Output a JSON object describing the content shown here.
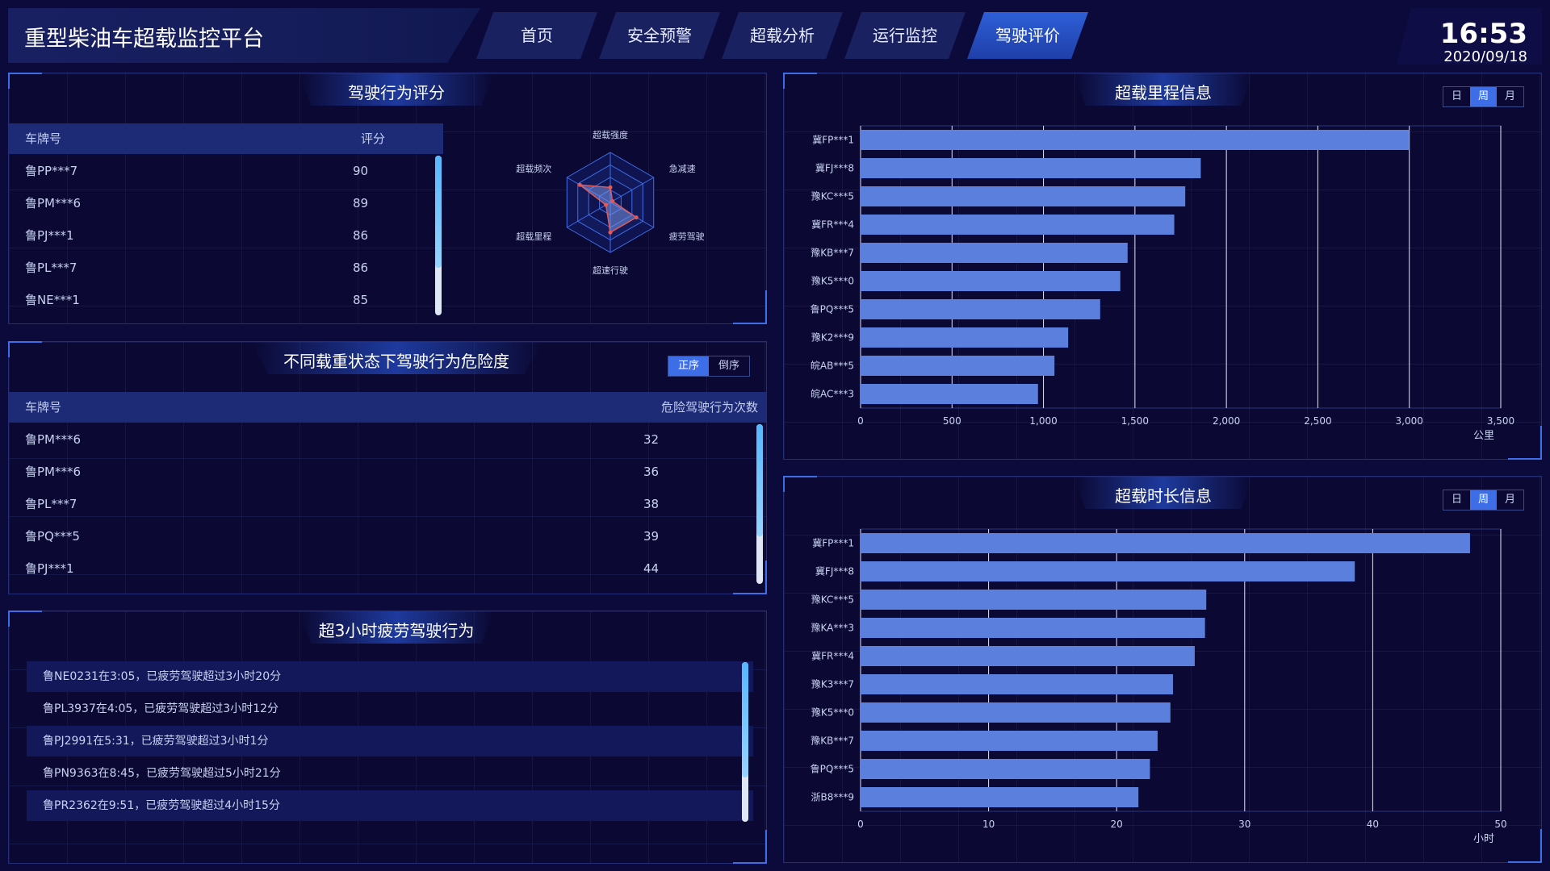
{
  "header": {
    "title": "重型柴油车超载监控平台",
    "tabs": [
      {
        "label": "首页",
        "active": false
      },
      {
        "label": "安全预警",
        "active": false
      },
      {
        "label": "超载分析",
        "active": false
      },
      {
        "label": "运行监控",
        "active": false
      },
      {
        "label": "驾驶评价",
        "active": true
      }
    ],
    "time": "16:53",
    "date": "2020/09/18"
  },
  "colors": {
    "accent": "#3d6ee8",
    "bar": "#5b7fdc",
    "background": "#0c0a3a",
    "radar_line": "#e05a5a"
  },
  "driving_score": {
    "title": "驾驶行为评分",
    "columns": [
      "车牌号",
      "评分"
    ],
    "rows": [
      {
        "plate": "鲁PP***7",
        "score": "90"
      },
      {
        "plate": "鲁PM***6",
        "score": "89"
      },
      {
        "plate": "鲁PJ***1",
        "score": "86"
      },
      {
        "plate": "鲁PL***7",
        "score": "86"
      },
      {
        "plate": "鲁NE***1",
        "score": "85"
      }
    ],
    "scroll_fraction": 0.7
  },
  "chart_data": [
    {
      "type": "radar",
      "indicators": [
        "超载强度",
        "急减速",
        "疲劳驾驶",
        "超速行驶",
        "超载里程",
        "超载频次"
      ],
      "values": [
        0.3,
        0.05,
        0.6,
        0.6,
        0.1,
        0.7
      ],
      "max": 1
    },
    {
      "type": "bar",
      "title": "超载里程信息",
      "orientation": "horizontal",
      "categories": [
        "冀FP***1",
        "冀FJ***8",
        "豫KC***5",
        "冀FR***4",
        "豫KB***7",
        "豫K5***0",
        "鲁PQ***5",
        "豫K2***9",
        "皖AB***5",
        "皖AC***3"
      ],
      "values": [
        3000,
        1860,
        1775,
        1715,
        1460,
        1420,
        1310,
        1135,
        1060,
        970
      ],
      "x_ticks": [
        "0",
        "500",
        "1,000",
        "1,500",
        "2,000",
        "2,500",
        "3,000",
        "3,500"
      ],
      "xlim": [
        0,
        3500
      ],
      "unit": "公里"
    },
    {
      "type": "bar",
      "title": "超载时长信息",
      "orientation": "horizontal",
      "categories": [
        "冀FP***1",
        "冀FJ***8",
        "豫KC***5",
        "豫KA***3",
        "冀FR***4",
        "豫K3***7",
        "豫K5***0",
        "豫KB***7",
        "鲁PQ***5",
        "浙B8***9"
      ],
      "values": [
        47.6,
        38.6,
        27,
        26.9,
        26.1,
        24.4,
        24.2,
        23.2,
        22.6,
        21.7
      ],
      "x_ticks": [
        "0",
        "10",
        "20",
        "30",
        "40",
        "50"
      ],
      "xlim": [
        0,
        50
      ],
      "unit": "小时"
    }
  ],
  "danger_table": {
    "title": "不同载重状态下驾驶行为危险度",
    "sort_labels": [
      "正序",
      "倒序"
    ],
    "columns": [
      "车牌号",
      "危险驾驶行为次数"
    ],
    "rows": [
      {
        "plate": "鲁PM***6",
        "count": "32"
      },
      {
        "plate": "鲁PM***6",
        "count": "36"
      },
      {
        "plate": "鲁PL***7",
        "count": "38"
      },
      {
        "plate": "鲁PQ***5",
        "count": "39"
      },
      {
        "plate": "鲁PJ***1",
        "count": "44"
      }
    ],
    "scroll_fraction": 0.7
  },
  "fatigue": {
    "title": "超3小时疲劳驾驶行为",
    "items": [
      "鲁NE0231在3:05，已疲劳驾驶超过3小时20分",
      "鲁PL3937在4:05，已疲劳驾驶超过3小时12分",
      "鲁PJ2991在5:31，已疲劳驾驶超过3小时1分",
      "鲁PN9363在8:45，已疲劳驾驶超过5小时21分",
      "鲁PR2362在9:51，已疲劳驾驶超过4小时15分"
    ],
    "scroll_fraction": 0.72
  },
  "period_toggle": {
    "options": [
      "日",
      "周",
      "月"
    ],
    "selected": "周"
  }
}
